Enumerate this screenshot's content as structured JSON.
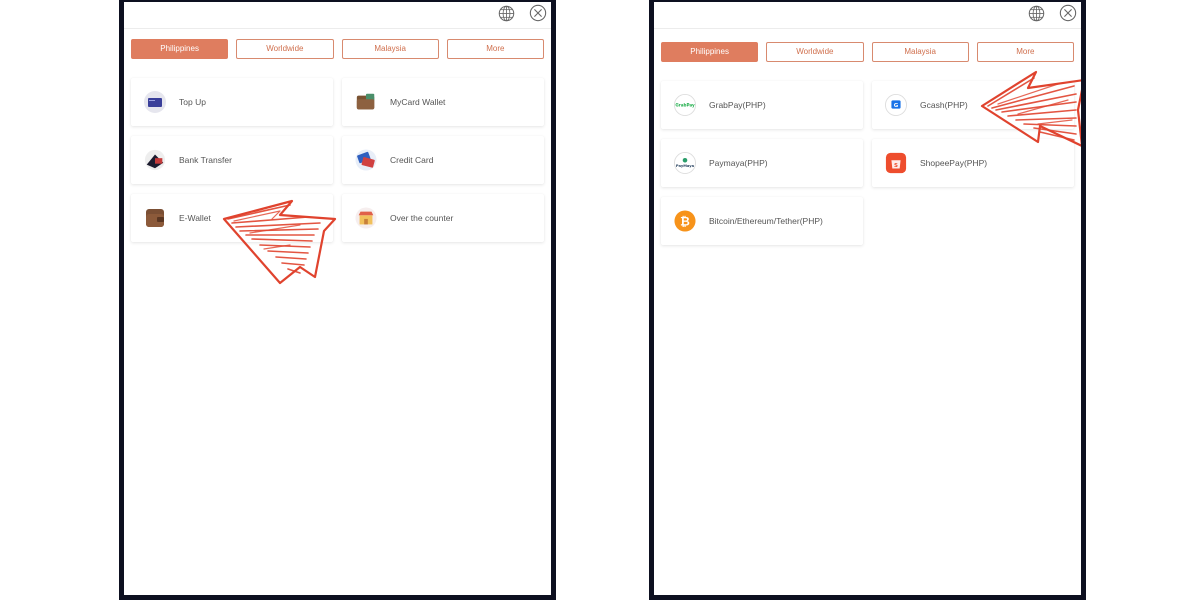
{
  "left_screen": {
    "tabs": [
      "Philippines",
      "Worldwide",
      "Malaysia",
      "More"
    ],
    "active_tab": "Philippines",
    "methods": [
      {
        "label": "Top Up",
        "icon": "topup-card-icon"
      },
      {
        "label": "MyCard Wallet",
        "icon": "mycard-wallet-icon"
      },
      {
        "label": "Bank Transfer",
        "icon": "bank-transfer-icon"
      },
      {
        "label": "Credit Card",
        "icon": "credit-card-icon"
      },
      {
        "label": "E-Wallet",
        "icon": "ewallet-icon"
      },
      {
        "label": "Over the counter",
        "icon": "store-icon"
      }
    ]
  },
  "right_screen": {
    "tabs": [
      "Philippines",
      "Worldwide",
      "Malaysia",
      "More"
    ],
    "active_tab": "Philippines",
    "methods": [
      {
        "label": "GrabPay(PHP)",
        "icon": "grabpay-icon"
      },
      {
        "label": "Gcash(PHP)",
        "icon": "gcash-icon"
      },
      {
        "label": "Paymaya(PHP)",
        "icon": "paymaya-icon"
      },
      {
        "label": "ShopeePay(PHP)",
        "icon": "shopeepay-icon"
      },
      {
        "label": "Bitcoin/Ethereum/Tether(PHP)",
        "icon": "bitcoin-icon"
      }
    ]
  },
  "icon_text": {
    "grabpay": "GrabPay",
    "gcash": "G",
    "paymaya": "PayMaya",
    "shopee": "S",
    "bitcoin": "₿"
  },
  "colors": {
    "accent": "#df7d5f",
    "annotation_arrow": "#e0432e",
    "bezel": "#0d1020"
  }
}
